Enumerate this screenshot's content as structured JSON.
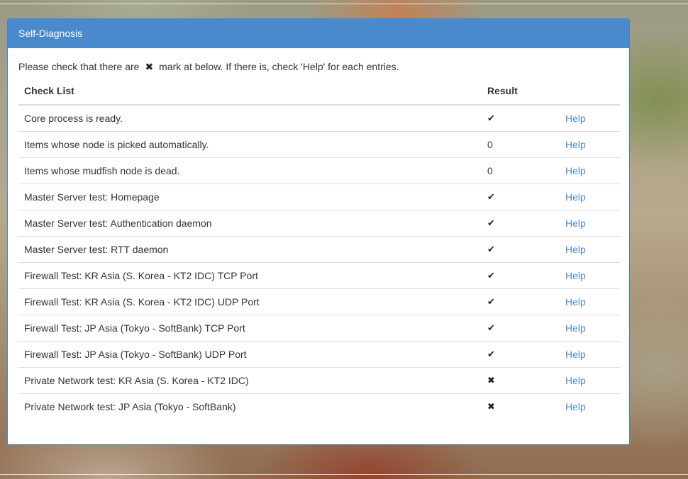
{
  "panel": {
    "title": "Self-Diagnosis",
    "intro_before": "Please check that there are",
    "intro_mark": "✖",
    "intro_after": "mark at below. If there is, check 'Help' for each entries."
  },
  "table": {
    "headers": {
      "check_list": "Check List",
      "result": "Result",
      "help": ""
    },
    "rows": [
      {
        "item": "Core process is ready.",
        "result": "✔",
        "result_icon": "check-icon",
        "help": "Help"
      },
      {
        "item": "Items whose node is picked automatically.",
        "result": "0",
        "result_icon": "",
        "help": "Help"
      },
      {
        "item": "Items whose mudfish node is dead.",
        "result": "0",
        "result_icon": "",
        "help": "Help"
      },
      {
        "item": "Master Server test: Homepage",
        "result": "✔",
        "result_icon": "check-icon",
        "help": "Help"
      },
      {
        "item": "Master Server test: Authentication daemon",
        "result": "✔",
        "result_icon": "check-icon",
        "help": "Help"
      },
      {
        "item": "Master Server test: RTT daemon",
        "result": "✔",
        "result_icon": "check-icon",
        "help": "Help"
      },
      {
        "item": "Firewall Test: KR Asia (S. Korea - KT2 IDC) TCP Port",
        "result": "✔",
        "result_icon": "check-icon",
        "help": "Help"
      },
      {
        "item": "Firewall Test: KR Asia (S. Korea - KT2 IDC) UDP Port",
        "result": "✔",
        "result_icon": "check-icon",
        "help": "Help"
      },
      {
        "item": "Firewall Test: JP Asia (Tokyo - SoftBank) TCP Port",
        "result": "✔",
        "result_icon": "check-icon",
        "help": "Help"
      },
      {
        "item": "Firewall Test: JP Asia (Tokyo - SoftBank) UDP Port",
        "result": "✔",
        "result_icon": "check-icon",
        "help": "Help"
      },
      {
        "item": "Private Network test: KR Asia (S. Korea - KT2 IDC)",
        "result": "✖",
        "result_icon": "x-mark-icon",
        "help": "Help"
      },
      {
        "item": "Private Network test: JP Asia (Tokyo - SoftBank)",
        "result": "✖",
        "result_icon": "x-mark-icon",
        "help": "Help"
      }
    ]
  },
  "colors": {
    "heading_bg": "#4a89cc",
    "link": "#4a89cc",
    "text": "#333333"
  }
}
